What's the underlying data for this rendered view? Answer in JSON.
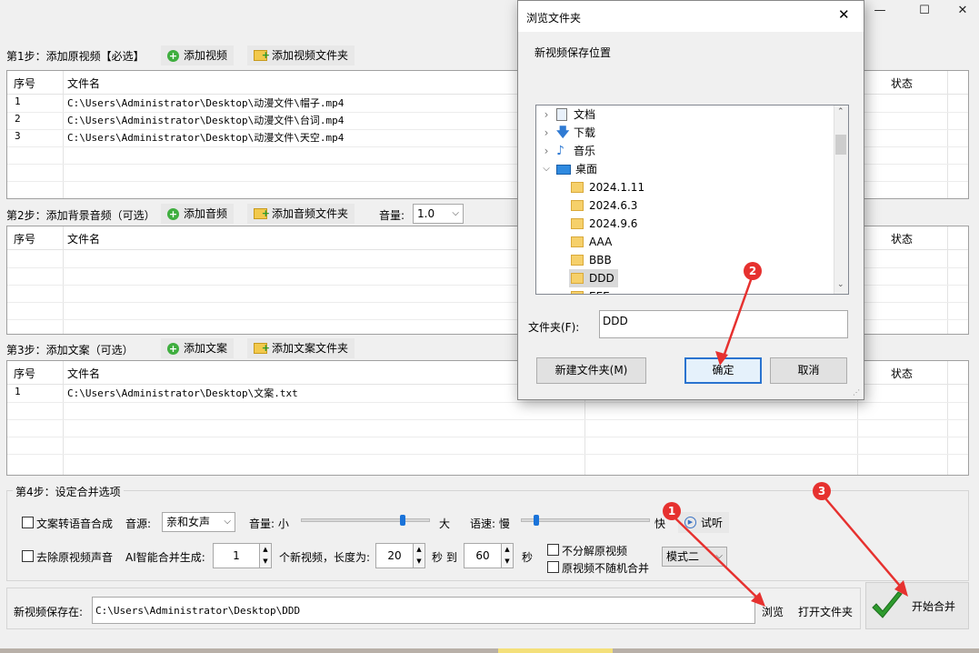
{
  "window": {
    "minimize": "—",
    "maximize": "☐",
    "close": "✕"
  },
  "step1": {
    "label": "第1步：添加原视频【必选】",
    "add_button": "添加视频",
    "add_folder_button": "添加视频文件夹",
    "columns": {
      "index": "序号",
      "filename": "文件名",
      "status": "状态"
    },
    "rows": [
      {
        "index": "1",
        "filename": "C:\\Users\\Administrator\\Desktop\\动漫文件\\帽子.mp4"
      },
      {
        "index": "2",
        "filename": "C:\\Users\\Administrator\\Desktop\\动漫文件\\台词.mp4"
      },
      {
        "index": "3",
        "filename": "C:\\Users\\Administrator\\Desktop\\动漫文件\\天空.mp4"
      }
    ]
  },
  "step2": {
    "label": "第2步：添加背景音频（可选）",
    "add_button": "添加音频",
    "add_folder_button": "添加音频文件夹",
    "volume_label": "音量:",
    "volume_value": "1.0",
    "columns": {
      "index": "序号",
      "filename": "文件名",
      "status": "状态"
    }
  },
  "step3": {
    "label": "第3步：添加文案（可选）",
    "add_button": "添加文案",
    "add_folder_button": "添加文案文件夹",
    "columns": {
      "index": "序号",
      "filename": "文件名",
      "status": "状态"
    },
    "rows": [
      {
        "index": "1",
        "filename": "C:\\Users\\Administrator\\Desktop\\文案.txt"
      }
    ]
  },
  "step4": {
    "label": "第4步：设定合并选项",
    "tts_checkbox": "文案转语音合成",
    "voice_label": "音源:",
    "voice_value": "亲和女声",
    "volume_label": "音量: 小",
    "volume_max": "大",
    "volume_level": 0.8,
    "speed_label": "语速: 慢",
    "speed_max": "快",
    "speed_level": 0.1,
    "preview_button": "试听",
    "remove_audio_checkbox": "去除原视频声音",
    "ai_label": "AI智能合并生成:",
    "count_value": "1",
    "count_suffix": "个新视频，长度为:",
    "min_value": "20",
    "sec_to": "秒 到",
    "max_value": "60",
    "sec": "秒",
    "no_split_checkbox": "不分解原视频",
    "no_random_checkbox": "原视频不随机合并",
    "mode_value": "模式二"
  },
  "save": {
    "label": "新视频保存在:",
    "path": "C:\\Users\\Administrator\\Desktop\\DDD",
    "browse_button": "浏览",
    "open_folder_button": "打开文件夹",
    "start_button": "开始合并"
  },
  "dialog": {
    "title": "浏览文件夹",
    "close": "✕",
    "subtitle": "新视频保存位置",
    "tree": [
      {
        "label": "文档",
        "icon": "document-icon"
      },
      {
        "label": "下载",
        "icon": "download-icon"
      },
      {
        "label": "音乐",
        "icon": "music-icon"
      },
      {
        "label": "桌面",
        "icon": "desktop-icon"
      },
      {
        "label": "2024.1.11",
        "icon": "folder-icon"
      },
      {
        "label": "2024.6.3",
        "icon": "folder-icon"
      },
      {
        "label": "2024.9.6",
        "icon": "folder-icon"
      },
      {
        "label": "AAA",
        "icon": "folder-icon"
      },
      {
        "label": "BBB",
        "icon": "folder-icon"
      },
      {
        "label": "DDD",
        "icon": "folder-icon"
      },
      {
        "label": "EEE",
        "icon": "folder-icon"
      }
    ],
    "folder_label": "文件夹(F):",
    "folder_value": "DDD",
    "new_folder_button": "新建文件夹(M)",
    "ok_button": "确定",
    "cancel_button": "取消"
  },
  "annotations": {
    "m1": "1",
    "m2": "2",
    "m3": "3"
  },
  "colors": {
    "marker": "#e6312f",
    "accent": "#1a73d9",
    "check": "#2e9b2e"
  }
}
